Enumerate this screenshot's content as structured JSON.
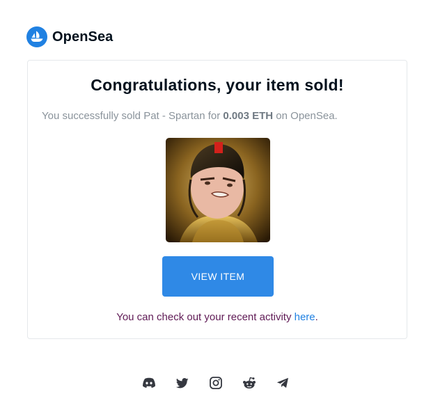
{
  "brand": {
    "name": "OpenSea",
    "logo_icon": "opensea-sailboat-icon",
    "accent": "#2081e2"
  },
  "email": {
    "title": "Congratulations, your item sold!",
    "message": {
      "prefix": "You successfully sold Pat - Spartan for ",
      "price": "0.003 ETH",
      "suffix": " on OpenSea."
    },
    "item_image": "pat-spartan-nft-image",
    "button": {
      "label": "VIEW ITEM",
      "color": "#2f89e6"
    },
    "activity": {
      "prefix": "You can check out your recent activity ",
      "link": "here",
      "suffix": "."
    }
  },
  "footer": {
    "socials": [
      "discord-icon",
      "twitter-icon",
      "instagram-icon",
      "reddit-icon",
      "telegram-icon"
    ]
  }
}
